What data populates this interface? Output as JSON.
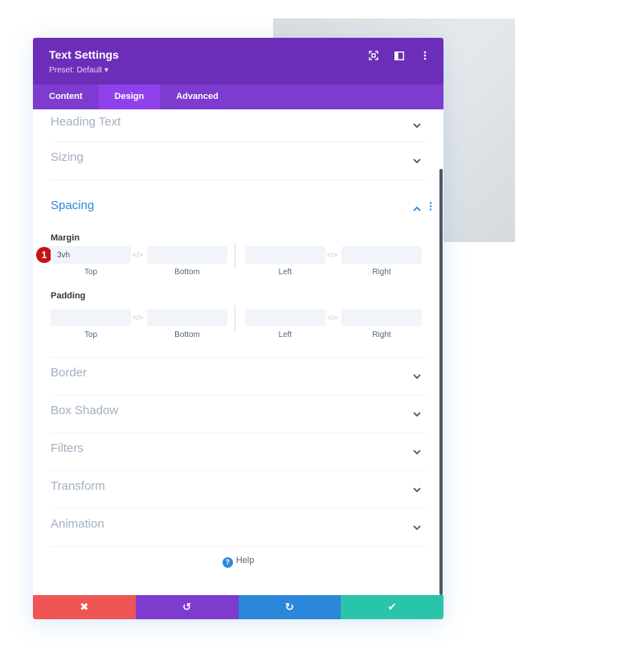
{
  "header": {
    "title": "Text Settings",
    "preset": "Preset: Default ▾",
    "icons": [
      "focus-mode-icon",
      "split-view-icon",
      "more-options-icon"
    ]
  },
  "tabs": [
    {
      "label": "Content",
      "active": false
    },
    {
      "label": "Design",
      "active": true
    },
    {
      "label": "Advanced",
      "active": false
    }
  ],
  "sections_top": [
    {
      "label": "Heading Text"
    },
    {
      "label": "Sizing"
    }
  ],
  "spacing": {
    "label": "Spacing",
    "margin": {
      "label": "Margin",
      "top": "3vh",
      "bottom": "",
      "left": "",
      "right": "",
      "badge": "1"
    },
    "padding": {
      "label": "Padding",
      "top": "",
      "bottom": "",
      "left": "",
      "right": ""
    },
    "sub_labels": {
      "top": "Top",
      "bottom": "Bottom",
      "left": "Left",
      "right": "Right"
    },
    "link_glyph": "</>"
  },
  "sections_bottom": [
    {
      "label": "Border"
    },
    {
      "label": "Box Shadow"
    },
    {
      "label": "Filters"
    },
    {
      "label": "Transform"
    },
    {
      "label": "Animation"
    }
  ],
  "help": {
    "label": "Help",
    "icon": "?"
  },
  "footer": {
    "cancel": {
      "glyph": "✖",
      "color": "#ef5555"
    },
    "undo": {
      "glyph": "↺",
      "color": "#7e3bd0"
    },
    "redo": {
      "glyph": "↻",
      "color": "#2b87da"
    },
    "save": {
      "glyph": "✔",
      "color": "#29c4a9"
    }
  }
}
